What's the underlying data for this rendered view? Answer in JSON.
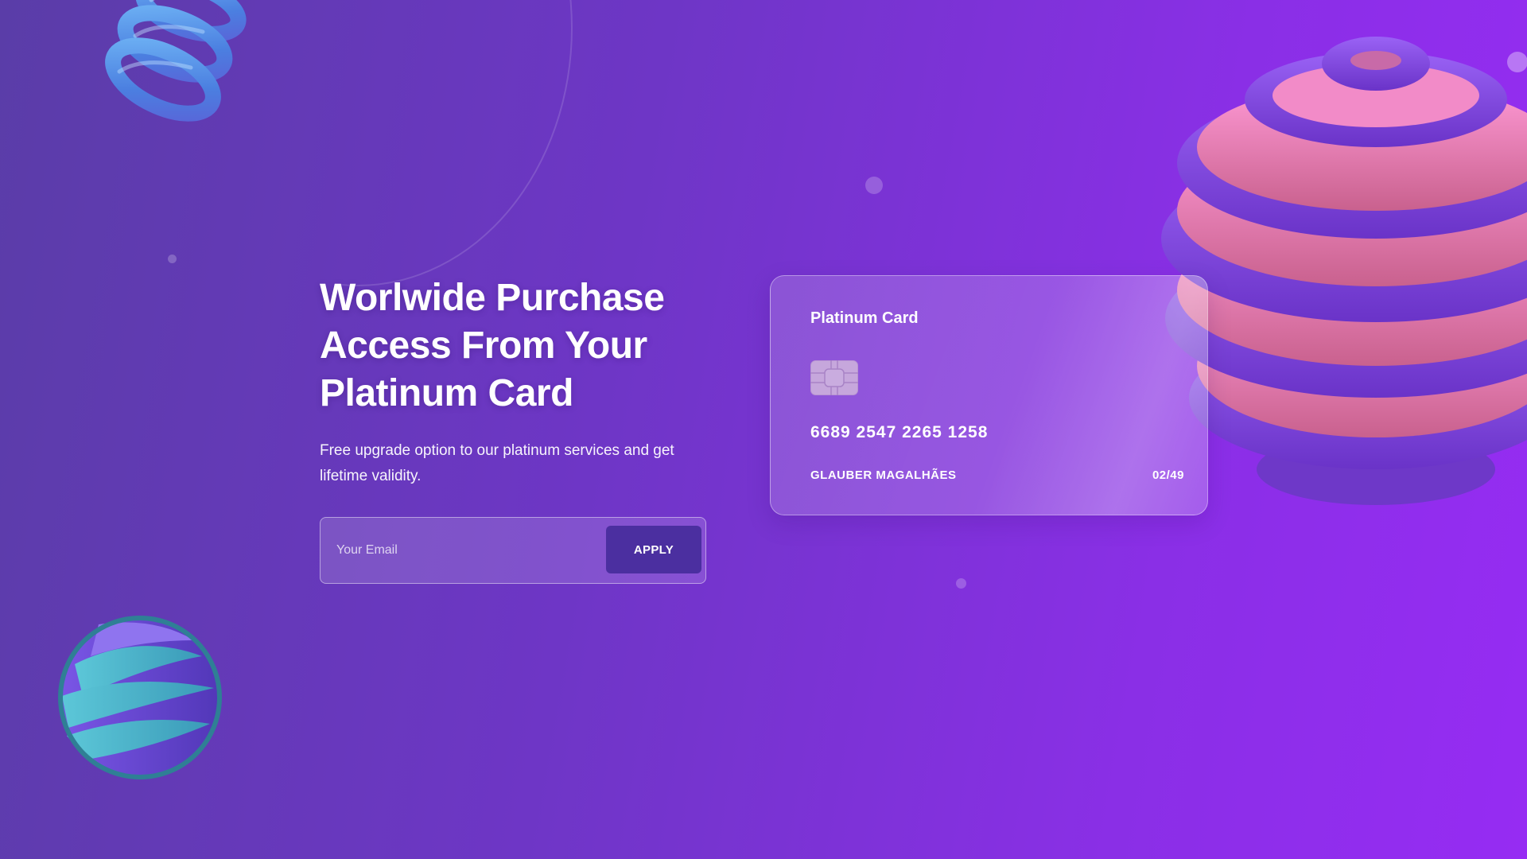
{
  "hero": {
    "title_lines": [
      "Worlwide Purchase",
      "Access From Your",
      "Platinum Card"
    ],
    "subtitle": "Free upgrade option to our platinum services and get lifetime validity."
  },
  "form": {
    "email_placeholder": "Your Email",
    "apply_label": "APPLY"
  },
  "card": {
    "title": "Platinum Card",
    "number": "6689 2547 2265 1258",
    "holder": "GLAUBER MAGALHÃES",
    "expiry": "02/49"
  },
  "icons": {
    "chip": "chip-icon",
    "spiral": "spiral-icon",
    "striped_ball": "striped-ball-icon",
    "layered_sphere": "layered-sphere-icon"
  },
  "colors": {
    "background_start": "#5a3da8",
    "background_end": "#962cf3",
    "apply_button": "#4b2fa0",
    "sphere_pink": "#f08bc8",
    "sphere_rings": "#8a4ef0",
    "spiral_blue": "#4f8fe8"
  }
}
